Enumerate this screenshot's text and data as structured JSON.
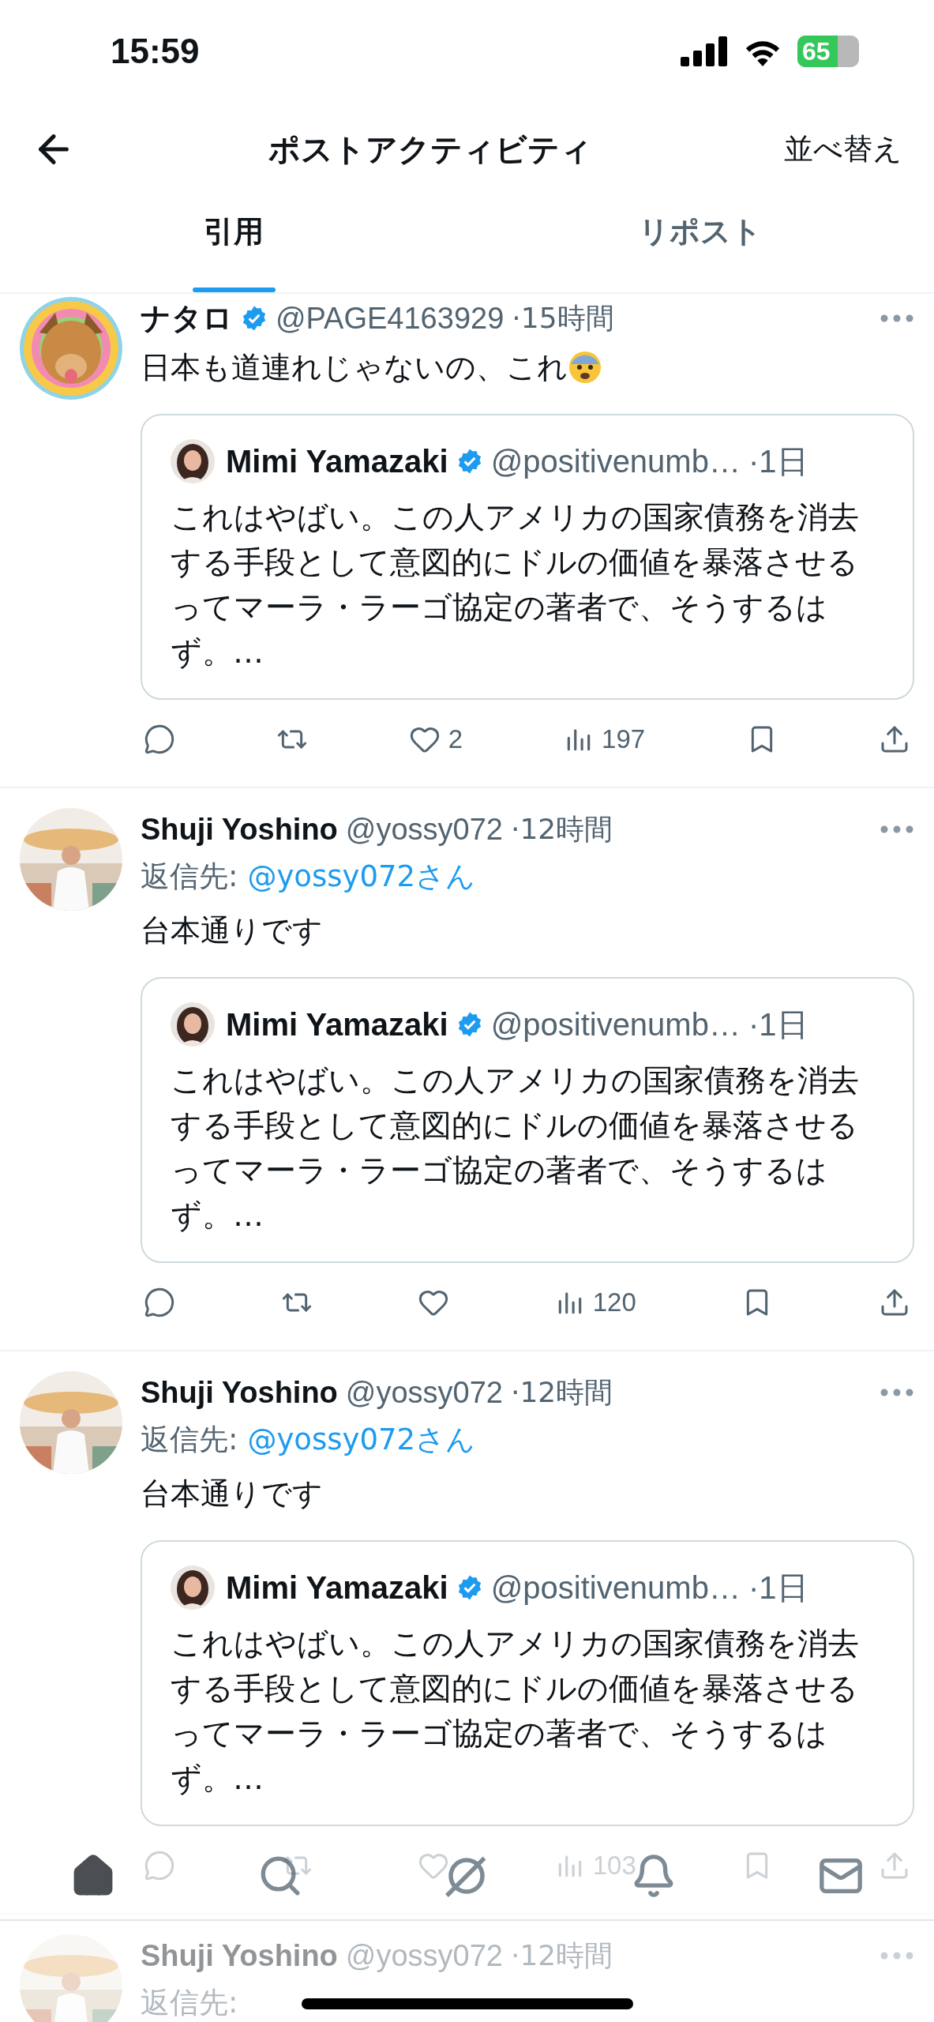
{
  "status_bar": {
    "time": "15:59",
    "battery": {
      "reading": "65",
      "level": 0.65
    }
  },
  "header": {
    "title": "ポストアクティビティ",
    "sort": "並べ替え"
  },
  "tabs": [
    {
      "label": "引用",
      "selected": true
    },
    {
      "label": "リポスト",
      "selected": false
    }
  ],
  "posts": [
    {
      "author": "ナタロ",
      "verified": true,
      "handle": "@PAGE4163929",
      "time": "·15時間",
      "text": "日本も道連れじゃないの、これ",
      "emoji": true,
      "quote": {
        "author": "Mimi Yamazaki",
        "verified": true,
        "handle": "@positivenumb…",
        "time": "·1日",
        "text": "これはやばい。この人アメリカの国家債務を消去する手段として意図的にドルの価値を暴落させるってマーラ・ラーゴ協定の著者で、そうするはず。…"
      },
      "actions": [
        {
          "kind": "reply"
        },
        {
          "kind": "repost"
        },
        {
          "kind": "like",
          "count": "2"
        },
        {
          "kind": "views",
          "count": "197"
        },
        {
          "kind": "bookmark"
        },
        {
          "kind": "share"
        }
      ]
    },
    {
      "author": "Shuji Yoshino",
      "verified": false,
      "handle": "@yossy072",
      "time": "·12時間",
      "reply_to": {
        "label": "返信先:",
        "handle": "@yossy072さん"
      },
      "text": "台本通りです",
      "emoji": false,
      "quote": {
        "author": "Mimi Yamazaki",
        "verified": true,
        "handle": "@positivenumb…",
        "time": "·1日",
        "text": "これはやばい。この人アメリカの国家債務を消去する手段として意図的にドルの価値を暴落させるってマーラ・ラーゴ協定の著者で、そうするはず。…"
      },
      "actions": [
        {
          "kind": "reply"
        },
        {
          "kind": "repost"
        },
        {
          "kind": "like"
        },
        {
          "kind": "views",
          "count": "120"
        },
        {
          "kind": "bookmark"
        },
        {
          "kind": "share"
        }
      ]
    },
    {
      "author": "Shuji Yoshino",
      "verified": false,
      "handle": "@yossy072",
      "time": "·12時間",
      "reply_to": {
        "label": "返信先:",
        "handle": "@yossy072さん"
      },
      "text": "台本通りです",
      "emoji": false,
      "quote": {
        "author": "Mimi Yamazaki",
        "verified": true,
        "handle": "@positivenumb…",
        "time": "·1日",
        "text": "これはやばい。この人アメリカの国家債務を消去する手段として意図的にドルの価値を暴落させるってマーラ・ラーゴ協定の著者で、そうするはず。…"
      },
      "actions": [
        {
          "kind": "reply"
        },
        {
          "kind": "repost"
        },
        {
          "kind": "like"
        },
        {
          "kind": "views",
          "count": "103"
        },
        {
          "kind": "bookmark"
        },
        {
          "kind": "share"
        }
      ]
    },
    {
      "author": "Shuji Yoshino",
      "verified": false,
      "handle": "@yossy072",
      "time": "·12時間",
      "reply_to": {
        "label": "返信先:"
      }
    }
  ],
  "bottom_nav": [
    {
      "kind": "home",
      "selected": true
    },
    {
      "kind": "search",
      "selected": false
    },
    {
      "kind": "grok",
      "selected": false
    },
    {
      "kind": "notifications",
      "selected": false
    },
    {
      "kind": "messages",
      "selected": false
    }
  ]
}
